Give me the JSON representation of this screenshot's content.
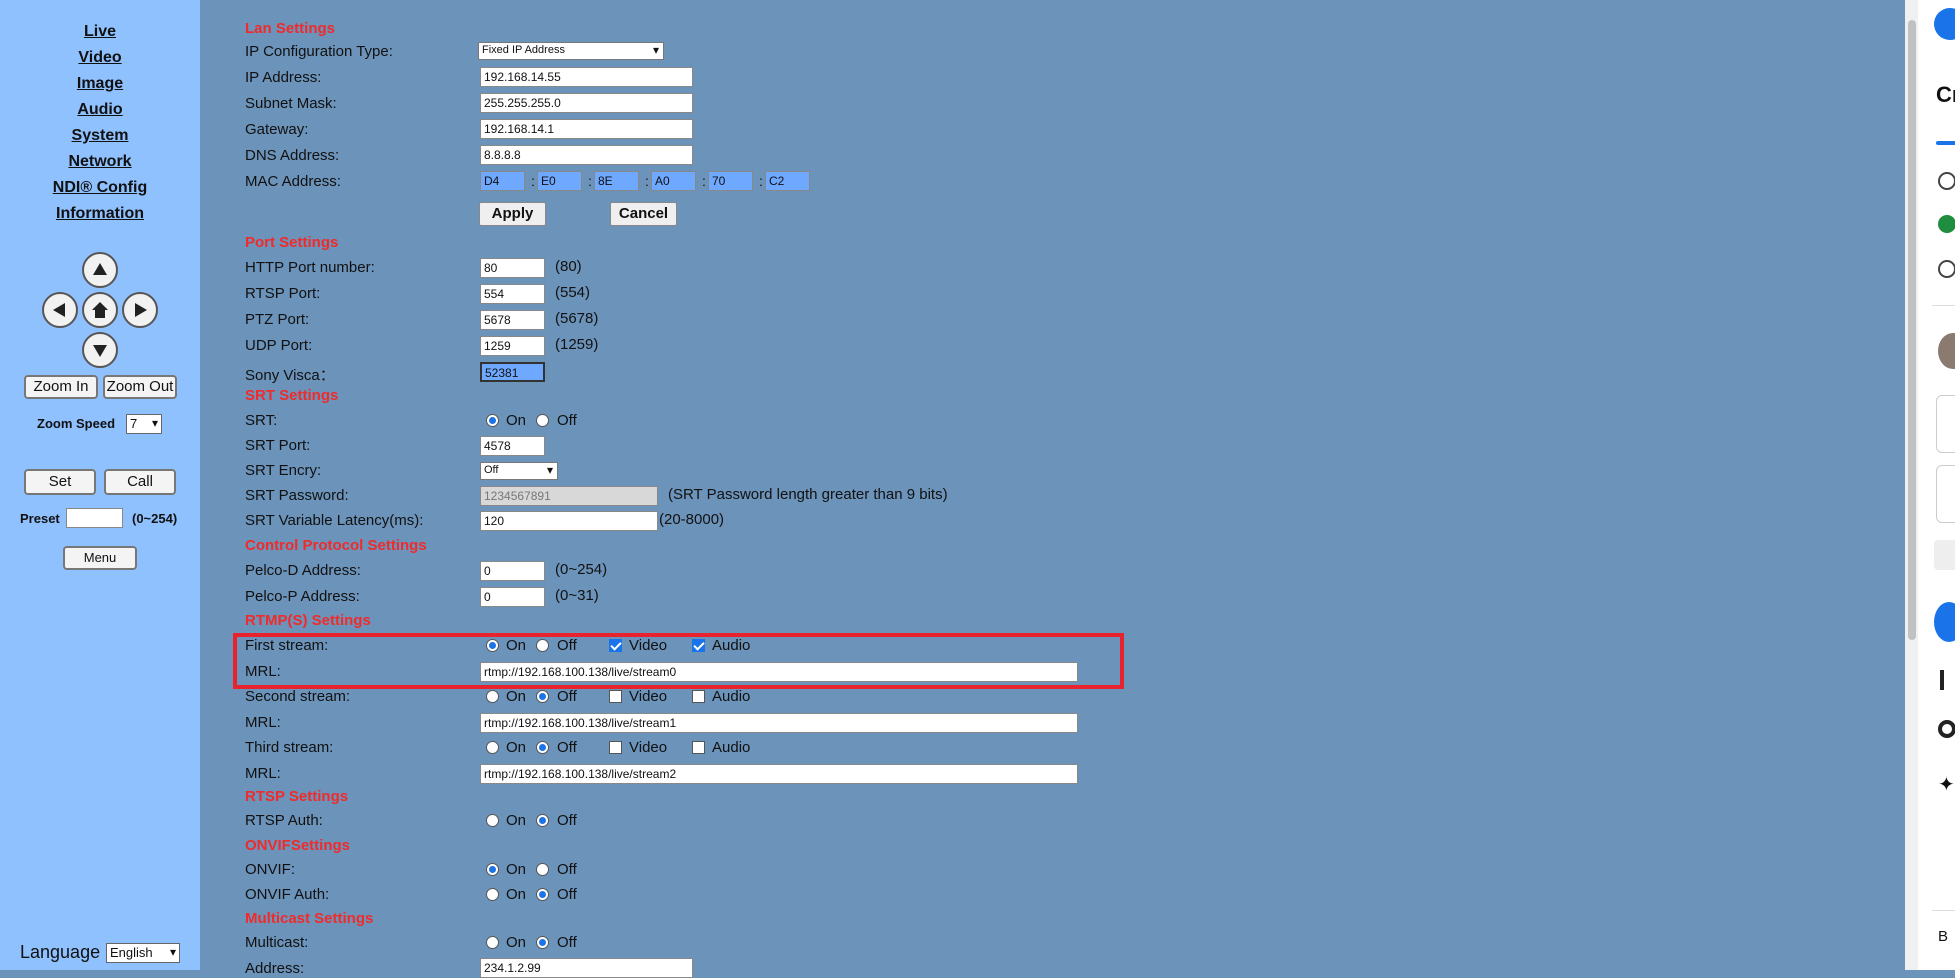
{
  "nav": [
    "Live",
    "Video",
    "Image",
    "Audio",
    "System",
    "Network",
    "NDI® Config",
    "Information"
  ],
  "ptz": {
    "zoom_in": "Zoom In",
    "zoom_out": "Zoom Out",
    "zoom_speed_label": "Zoom Speed",
    "zoom_speed_value": "7",
    "set": "Set",
    "call": "Call",
    "preset_label": "Preset",
    "preset_value": "",
    "preset_range": "(0~254)",
    "menu": "Menu"
  },
  "language": {
    "label": "Language",
    "value": "English"
  },
  "lan": {
    "title": "Lan Settings",
    "ip_type_label": "IP Configuration Type:",
    "ip_type_value": "Fixed IP Address",
    "ip_label": "IP Address:",
    "ip_value": "192.168.14.55",
    "subnet_label": "Subnet Mask:",
    "subnet_value": "255.255.255.0",
    "gateway_label": "Gateway:",
    "gateway_value": "192.168.14.1",
    "dns_label": "DNS Address:",
    "dns_value": "8.8.8.8",
    "mac_label": "MAC Address:",
    "mac": [
      "D4",
      "E0",
      "8E",
      "A0",
      "70",
      "C2"
    ],
    "apply": "Apply",
    "cancel": "Cancel"
  },
  "port": {
    "title": "Port Settings",
    "http_label": "HTTP Port number:",
    "http_value": "80",
    "http_hint": "(80)",
    "rtsp_label": "RTSP Port:",
    "rtsp_value": "554",
    "rtsp_hint": "(554)",
    "ptz_label": "PTZ Port:",
    "ptz_value": "5678",
    "ptz_hint": "(5678)",
    "udp_label": "UDP Port:",
    "udp_value": "1259",
    "udp_hint": "(1259)",
    "visca_label": "Sony Visca：",
    "visca_value": "52381"
  },
  "srt": {
    "title": "SRT Settings",
    "srt_label": "SRT:",
    "on": "On",
    "off": "Off",
    "port_label": "SRT Port:",
    "port_value": "4578",
    "encry_label": "SRT Encry:",
    "encry_value": "Off",
    "password_label": "SRT Password:",
    "password_value": "1234567891",
    "password_hint": "(SRT Password length greater than 9 bits)",
    "latency_label": "SRT Variable Latency(ms):",
    "latency_value": "120",
    "latency_hint": "(20-8000)"
  },
  "control": {
    "title": "Control Protocol Settings",
    "pelco_d_label": "Pelco-D Address:",
    "pelco_d_value": "0",
    "pelco_d_hint": "(0~254)",
    "pelco_p_label": "Pelco-P Address:",
    "pelco_p_value": "0",
    "pelco_p_hint": "(0~31)"
  },
  "rtmp": {
    "title": "RTMP(S) Settings",
    "on": "On",
    "off": "Off",
    "video": "Video",
    "audio": "Audio",
    "mrl_label": "MRL:",
    "first_label": "First stream:",
    "first_mrl": "rtmp://192.168.100.138/live/stream0",
    "second_label": "Second stream:",
    "second_mrl": "rtmp://192.168.100.138/live/stream1",
    "third_label": "Third stream:",
    "third_mrl": "rtmp://192.168.100.138/live/stream2"
  },
  "rtsp": {
    "title": "RTSP Settings",
    "auth_label": "RTSP Auth:",
    "on": "On",
    "off": "Off"
  },
  "onvif": {
    "title": "ONVIFSettings",
    "onvif_label": "ONVIF:",
    "auth_label": "ONVIF Auth:",
    "on": "On",
    "off": "Off"
  },
  "multicast": {
    "title": "Multicast Settings",
    "label": "Multicast:",
    "on": "On",
    "off": "Off",
    "address_label": "Address:",
    "address_value": "234.1.2.99"
  },
  "colors": {
    "sidebar_bg": "#8fc1ff",
    "main_bg": "#6c93ba",
    "section_red": "#ef2b2b",
    "highlight": "#e8232e"
  }
}
